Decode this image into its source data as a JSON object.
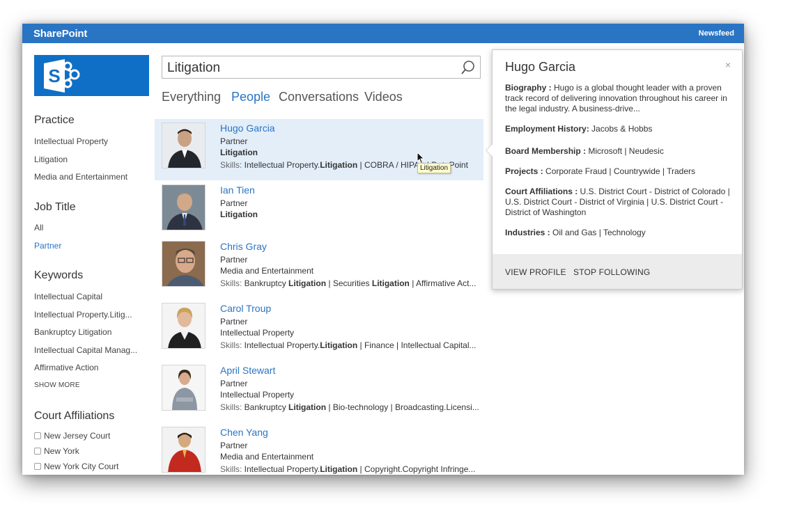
{
  "topbar": {
    "brand": "SharePoint",
    "right_link": "Newsfeed"
  },
  "logo": {
    "icon": "sharepoint-logo",
    "color": "#0f6fc6"
  },
  "accent_color": "#2a74c4",
  "refiners": {
    "practice": {
      "title": "Practice",
      "items": [
        "Intellectual Property",
        "Litigation",
        "Media and Entertainment"
      ]
    },
    "job_title": {
      "title": "Job Title",
      "items": [
        "All",
        "Partner"
      ],
      "selected": "Partner"
    },
    "keywords": {
      "title": "Keywords",
      "items": [
        "Intellectual Capital",
        "Intellectual Property.Litig...",
        "Bankruptcy Litigation",
        "Intellectual Capital Manag...",
        "Affirmative Action"
      ],
      "show_more": "SHOW MORE"
    },
    "court_affiliations": {
      "title": "Court Affiliations",
      "items": [
        "New Jersey Court",
        "New York",
        "New York City Court"
      ]
    }
  },
  "search": {
    "value": "Litigation",
    "icon": "search-icon"
  },
  "verticals": [
    {
      "label": "Everything",
      "active": false
    },
    {
      "label": "People",
      "active": true
    },
    {
      "label": "Conversations",
      "active": false
    },
    {
      "label": "Videos",
      "active": false
    }
  ],
  "results": [
    {
      "name": "Hugo Garcia",
      "role": "Partner",
      "dept": "Litigation",
      "dept_bold": true,
      "skills_label": "Skills:",
      "skills_pre": " Intellectual Property.",
      "skills_hit": "Litigation",
      "skills_post": " | COBRA / HIPAA | DataPoint"
    },
    {
      "name": "Ian Tien",
      "role": "Partner",
      "dept": "Litigation",
      "dept_bold": true
    },
    {
      "name": "Chris Gray",
      "role": "Partner",
      "dept": "Media and Entertainment",
      "skills_label": "Skills:",
      "skills_pre": " Bankruptcy ",
      "skills_hit": "Litigation",
      "skills_mid": " | Securities ",
      "skills_hit2": "Litigation",
      "skills_post": " | Affirmative Act..."
    },
    {
      "name": "Carol Troup",
      "role": "Partner",
      "dept": "Intellectual Property",
      "skills_label": "Skills:",
      "skills_pre": " Intellectual Property.",
      "skills_hit": "Litigation",
      "skills_post": " | Finance | Intellectual Capital..."
    },
    {
      "name": "April Stewart",
      "role": "Partner",
      "dept": "Intellectual Property",
      "skills_label": "Skills:",
      "skills_pre": " Bankruptcy ",
      "skills_hit": "Litigation",
      "skills_post": " | Bio-technology | Broadcasting.Licensi..."
    },
    {
      "name": "Chen Yang",
      "role": "Partner",
      "dept": "Media and Entertainment",
      "skills_label": "Skills:",
      "skills_pre": " Intellectual Property.",
      "skills_hit": "Litigation",
      "skills_post": " | Copyright.Copyright Infringe..."
    }
  ],
  "tooltip": "Litigation",
  "hover_card": {
    "name": "Hugo Garcia",
    "close": "×",
    "biography_label": "Biography :",
    "biography": " Hugo is a global thought leader with a proven track record of delivering innovation throughout his career in the legal industry. A business-drive...",
    "employment_label": "Employment History:",
    "employment": " Jacobs & Hobbs",
    "board_label": "Board Membership :",
    "board": " Microsoft | Neudesic",
    "projects_label": "Projects :",
    "projects": " Corporate Fraud | Countrywide | Traders",
    "court_label": "Court Affiliations :",
    "court": " U.S. District Court - District of Colorado | U.S. District Court - District of Virginia | U.S. District Court - District of Washington",
    "industries_label": "Industries :",
    "industries": " Oil and Gas | Technology",
    "view_profile": "VIEW PROFILE",
    "stop_following": "STOP FOLLOWING"
  }
}
